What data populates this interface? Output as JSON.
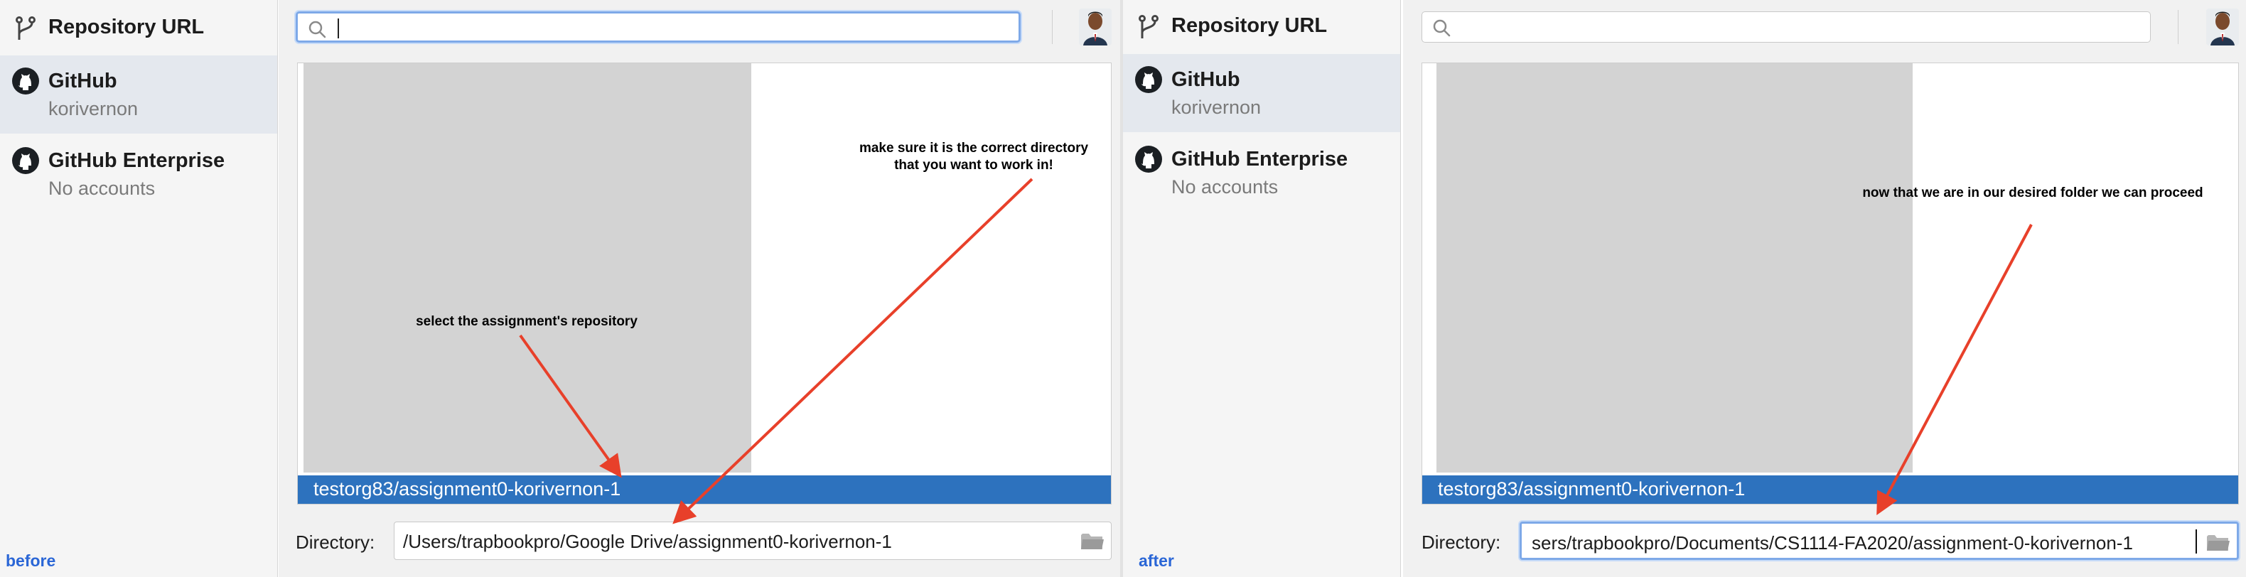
{
  "panels": {
    "before": {
      "caption": "before",
      "sidebar": {
        "repository_url": "Repository URL",
        "github": {
          "title": "GitHub",
          "account": "korivernon"
        },
        "github_enterprise": {
          "title": "GitHub Enterprise",
          "account": "No accounts"
        }
      },
      "search": {
        "value": "",
        "placeholder": ""
      },
      "selected_repo": "testorg83/assignment0-korivernon-1",
      "directory": {
        "label": "Directory:",
        "value": "/Users/trapbookpro/Google Drive/assignment0-korivernon-1"
      },
      "annotations": {
        "select_repo": "select the assignment's repository",
        "correct_dir_line1": "make sure it is the correct directory",
        "correct_dir_line2": "that you want to work in!"
      }
    },
    "after": {
      "caption": "after",
      "sidebar": {
        "repository_url": "Repository URL",
        "github": {
          "title": "GitHub",
          "account": "korivernon"
        },
        "github_enterprise": {
          "title": "GitHub Enterprise",
          "account": "No accounts"
        }
      },
      "search": {
        "value": "",
        "placeholder": ""
      },
      "selected_repo": "testorg83/assignment0-korivernon-1",
      "directory": {
        "label": "Directory:",
        "value": "sers/trapbookpro/Documents/CS1114-FA2020/assignment-0-korivernon-1"
      },
      "annotations": {
        "proceed": "now that we are in our desired folder we can proceed"
      }
    }
  },
  "icons": {
    "repository_url": "git-branch-icon",
    "github": "github-icon",
    "github_enterprise": "github-icon",
    "search": "search-icon",
    "folder": "folder-icon",
    "avatar": "avatar"
  },
  "colors": {
    "selection": "#2d72be",
    "focus_ring": "#7ea9e8",
    "arrow": "#e8402a",
    "caption": "#2a66d6"
  }
}
